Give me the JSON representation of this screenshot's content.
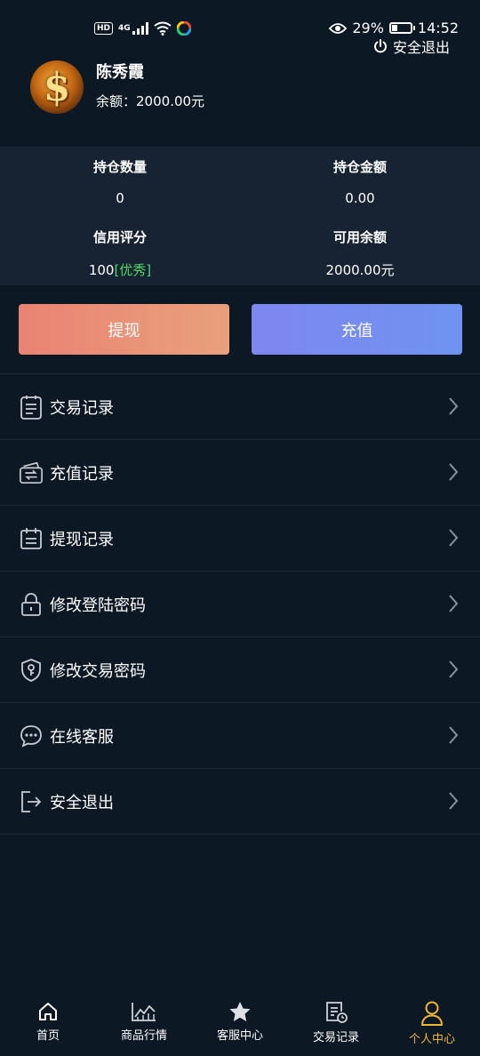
{
  "status_bar": {
    "network_badge": "HD",
    "network_type": "4G",
    "battery_percent": "29%",
    "battery_level": 0.29,
    "time": "14:52"
  },
  "header": {
    "logout_label": "安全退出"
  },
  "profile": {
    "name": "陈秀霞",
    "balance_label": "余额：",
    "balance_value": "2000.00元"
  },
  "stats": {
    "holding_qty_label": "持仓数量",
    "holding_qty_value": "0",
    "holding_amount_label": "持仓金额",
    "holding_amount_value": "0.00",
    "credit_label": "信用评分",
    "credit_value": "100",
    "credit_grade": "[优秀]",
    "available_label": "可用余额",
    "available_value": "2000.00元"
  },
  "actions": {
    "withdraw_label": "提现",
    "recharge_label": "充值"
  },
  "menu": {
    "items": [
      {
        "label": "交易记录",
        "icon": "document-icon"
      },
      {
        "label": "充值记录",
        "icon": "wallet-icon"
      },
      {
        "label": "提现记录",
        "icon": "calendar-icon"
      },
      {
        "label": "修改登陆密码",
        "icon": "lock-icon"
      },
      {
        "label": "修改交易密码",
        "icon": "shield-key-icon"
      },
      {
        "label": "在线客服",
        "icon": "chat-icon"
      },
      {
        "label": "安全退出",
        "icon": "exit-icon"
      }
    ]
  },
  "tabbar": {
    "items": [
      {
        "label": "首页",
        "icon": "home-icon"
      },
      {
        "label": "商品行情",
        "icon": "chart-icon"
      },
      {
        "label": "客服中心",
        "icon": "star-icon"
      },
      {
        "label": "交易记录",
        "icon": "receipt-icon"
      },
      {
        "label": "个人中心",
        "icon": "person-icon"
      }
    ],
    "active_index": 4,
    "active_color": "#f2b632"
  },
  "colors": {
    "background": "#0d1825",
    "stats_background": "#172333",
    "withdraw_button": "#e98373",
    "recharge_button": "#7e86f0",
    "credit_grade": "#4cd964"
  }
}
